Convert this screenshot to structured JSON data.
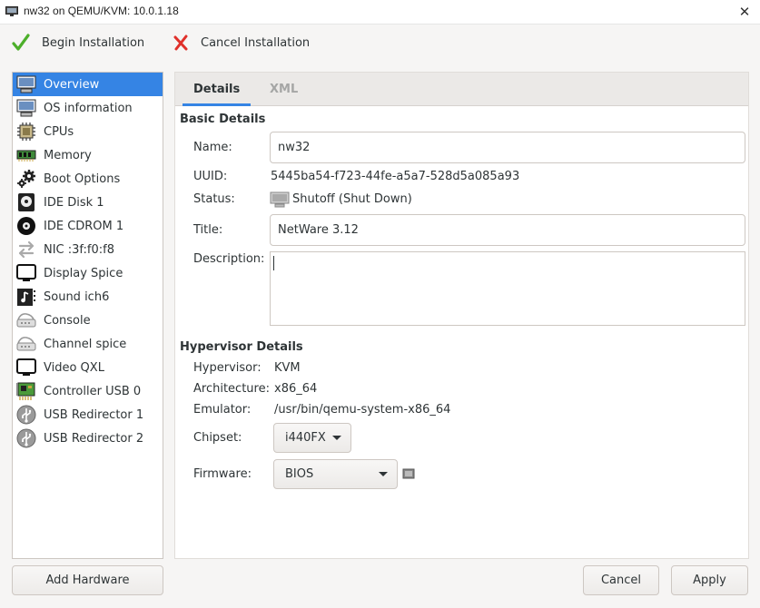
{
  "window": {
    "title": "nw32 on QEMU/KVM: 10.0.1.18",
    "close_glyph": "✕"
  },
  "toolbar": {
    "begin_label": "Begin Installation",
    "cancel_label": "Cancel Installation"
  },
  "sidebar": {
    "items": [
      {
        "label": "Overview",
        "icon": "monitor-icon",
        "selected": true
      },
      {
        "label": "OS information",
        "icon": "monitor-icon"
      },
      {
        "label": "CPUs",
        "icon": "cpu-icon"
      },
      {
        "label": "Memory",
        "icon": "memory-icon"
      },
      {
        "label": "Boot Options",
        "icon": "gears-icon"
      },
      {
        "label": "IDE Disk 1",
        "icon": "disk-icon"
      },
      {
        "label": "IDE CDROM 1",
        "icon": "cdrom-icon"
      },
      {
        "label": "NIC :3f:f0:f8",
        "icon": "network-arrows-icon"
      },
      {
        "label": "Display Spice",
        "icon": "display-icon"
      },
      {
        "label": "Sound ich6",
        "icon": "sound-icon"
      },
      {
        "label": "Console",
        "icon": "serial-icon"
      },
      {
        "label": "Channel spice",
        "icon": "serial-icon"
      },
      {
        "label": "Video QXL",
        "icon": "display-icon"
      },
      {
        "label": "Controller USB 0",
        "icon": "controller-card-icon"
      },
      {
        "label": "USB Redirector 1",
        "icon": "usb-icon"
      },
      {
        "label": "USB Redirector 2",
        "icon": "usb-icon"
      }
    ],
    "add_hardware_label": "Add Hardware"
  },
  "tabs": [
    {
      "label": "Details",
      "active": true
    },
    {
      "label": "XML",
      "active": false
    }
  ],
  "basic": {
    "section_title": "Basic Details",
    "name_label": "Name:",
    "name_value": "nw32",
    "uuid_label": "UUID:",
    "uuid_value": "5445ba54-f723-44fe-a5a7-528d5a085a93",
    "status_label": "Status:",
    "status_value": "Shutoff (Shut Down)",
    "title_label": "Title:",
    "title_value": "NetWare 3.12",
    "description_label": "Description:",
    "description_value": ""
  },
  "hypervisor": {
    "section_title": "Hypervisor Details",
    "hypervisor_label": "Hypervisor:",
    "hypervisor_value": "KVM",
    "arch_label": "Architecture:",
    "arch_value": "x86_64",
    "emulator_label": "Emulator:",
    "emulator_value": "/usr/bin/qemu-system-x86_64",
    "chipset_label": "Chipset:",
    "chipset_value": "i440FX",
    "firmware_label": "Firmware:",
    "firmware_value": "BIOS"
  },
  "buttons": {
    "cancel_label": "Cancel",
    "apply_label": "Apply"
  },
  "colors": {
    "accent": "#3584e4",
    "begin_check": "#4caf2a",
    "cancel_x": "#e0302a"
  }
}
